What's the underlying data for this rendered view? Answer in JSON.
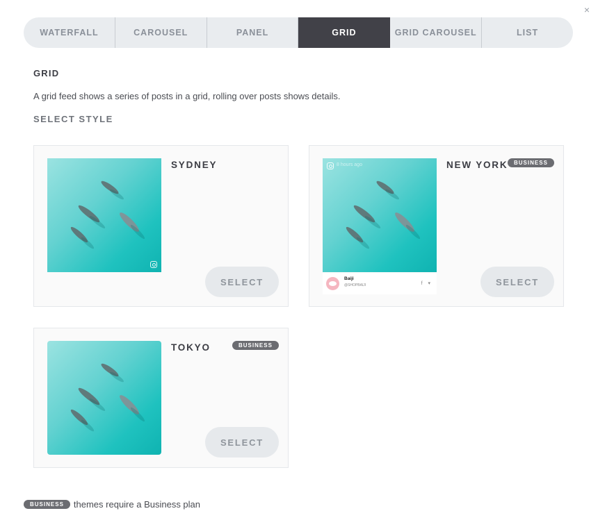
{
  "close_label": "×",
  "tabs": [
    {
      "label": "WATERFALL",
      "active": false
    },
    {
      "label": "CAROUSEL",
      "active": false
    },
    {
      "label": "PANEL",
      "active": false
    },
    {
      "label": "GRID",
      "active": true
    },
    {
      "label": "GRID CAROUSEL",
      "active": false
    },
    {
      "label": "LIST",
      "active": false
    }
  ],
  "section": {
    "title": "GRID",
    "description": "A grid feed shows a series of posts in a grid, rolling over posts shows details.",
    "select_style_label": "SELECT STYLE"
  },
  "styles": [
    {
      "name": "SYDNEY",
      "badge": "",
      "button": "SELECT",
      "icon": "instagram-icon"
    },
    {
      "name": "NEW YORK",
      "badge": "BUSINESS",
      "button": "SELECT",
      "icon": "instagram-icon",
      "preview": {
        "time": "8 hours ago",
        "user": "Baiji",
        "handle": "@SHOPBAIJI",
        "social": "f ▾"
      }
    },
    {
      "name": "TOKYO",
      "badge": "BUSINESS",
      "button": "SELECT",
      "icon": ""
    }
  ],
  "footnote": {
    "badge": "BUSINESS",
    "text": "themes require a Business plan"
  },
  "colors": {
    "active_tab": "#414148",
    "badge": "#6b6c71",
    "water": "#1fc2bf"
  }
}
